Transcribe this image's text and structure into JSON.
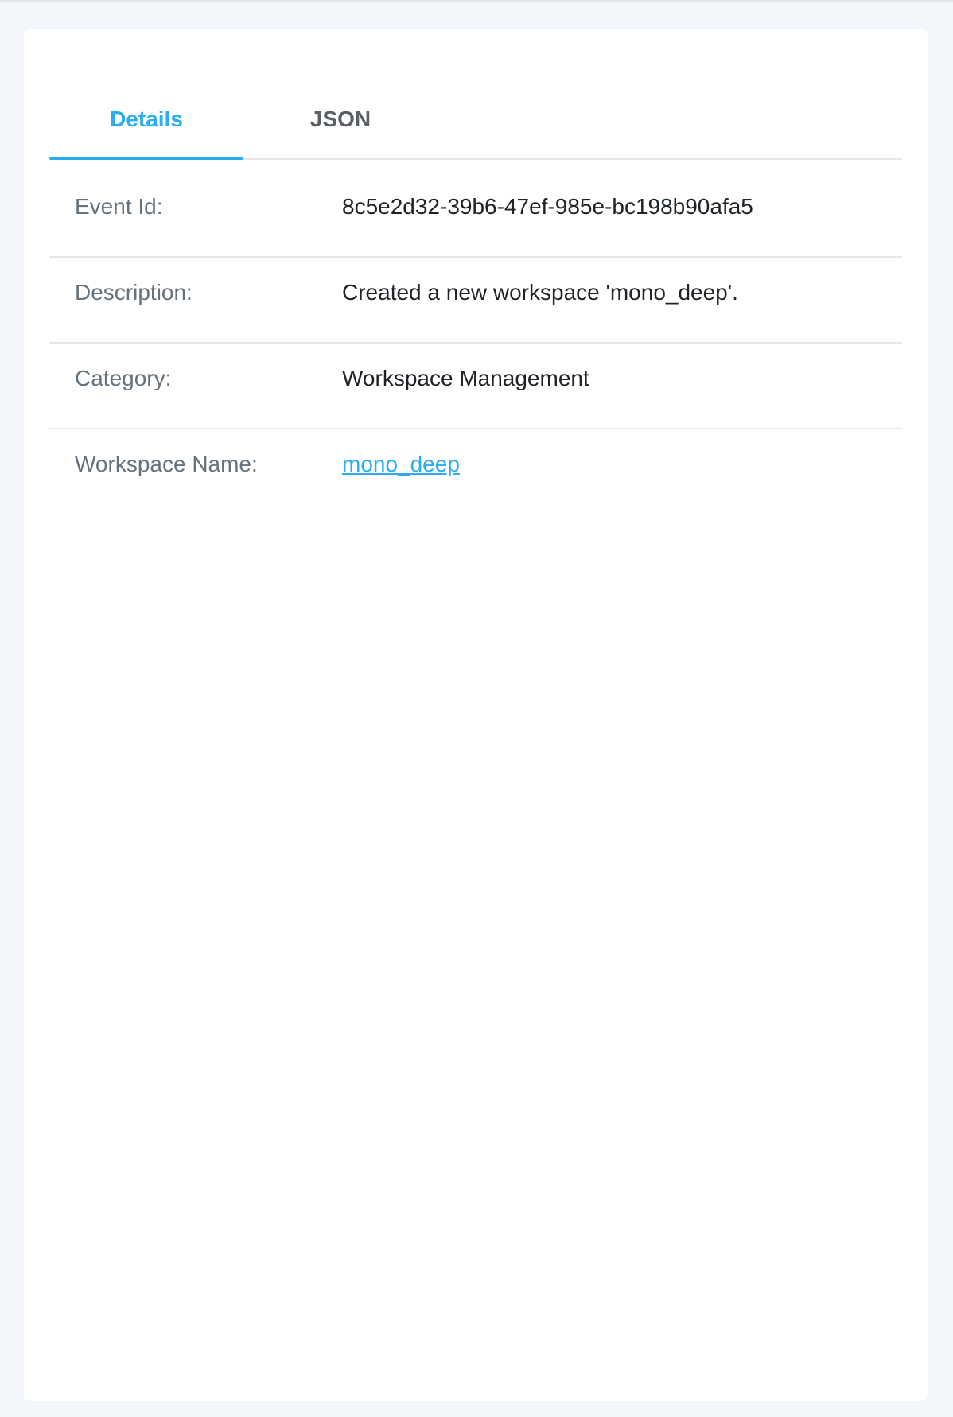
{
  "tabs": [
    {
      "label": "Details",
      "active": true
    },
    {
      "label": "JSON",
      "active": false
    }
  ],
  "details": {
    "event_id": {
      "label": "Event Id:",
      "value": "8c5e2d32-39b6-47ef-985e-bc198b90afa5"
    },
    "description": {
      "label": "Description:",
      "value": "Created a new workspace 'mono_deep'."
    },
    "category": {
      "label": "Category:",
      "value": "Workspace Management"
    },
    "workspace_name": {
      "label": "Workspace Name:",
      "value": "mono_deep"
    }
  },
  "colors": {
    "accent": "#2aaef1",
    "page_background": "#f3f7fc",
    "card_background": "#ffffff",
    "label_text": "#67737c",
    "value_text": "#1f2328",
    "divider": "#e3e6ea"
  }
}
